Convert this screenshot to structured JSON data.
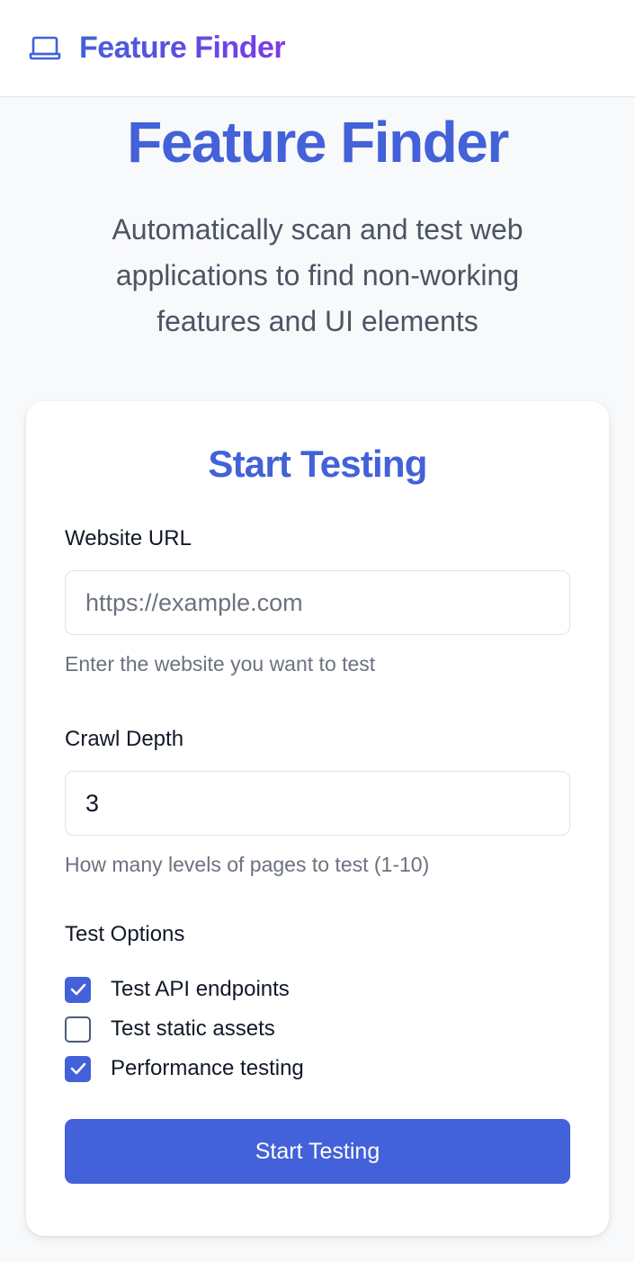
{
  "navbar": {
    "icon": "laptop-icon",
    "brand": "Feature Finder"
  },
  "hero": {
    "title": "Feature Finder",
    "subtitle": "Automatically scan and test web applications to find non-working features and UI elements"
  },
  "form": {
    "title": "Start Testing",
    "url": {
      "label": "Website URL",
      "placeholder": "https://example.com",
      "value": "",
      "help": "Enter the website you want to test"
    },
    "depth": {
      "label": "Crawl Depth",
      "value": "3",
      "help": "How many levels of pages to test (1-10)"
    },
    "options": {
      "label": "Test Options",
      "items": [
        {
          "label": "Test API endpoints",
          "checked": true
        },
        {
          "label": "Test static assets",
          "checked": false
        },
        {
          "label": "Performance testing",
          "checked": true
        }
      ]
    },
    "submit_label": "Start Testing"
  },
  "colors": {
    "primary": "#4361d8",
    "gradient_end": "#7c3ae6",
    "page_bg": "#f8f9fb",
    "muted_text": "#6b7280"
  }
}
